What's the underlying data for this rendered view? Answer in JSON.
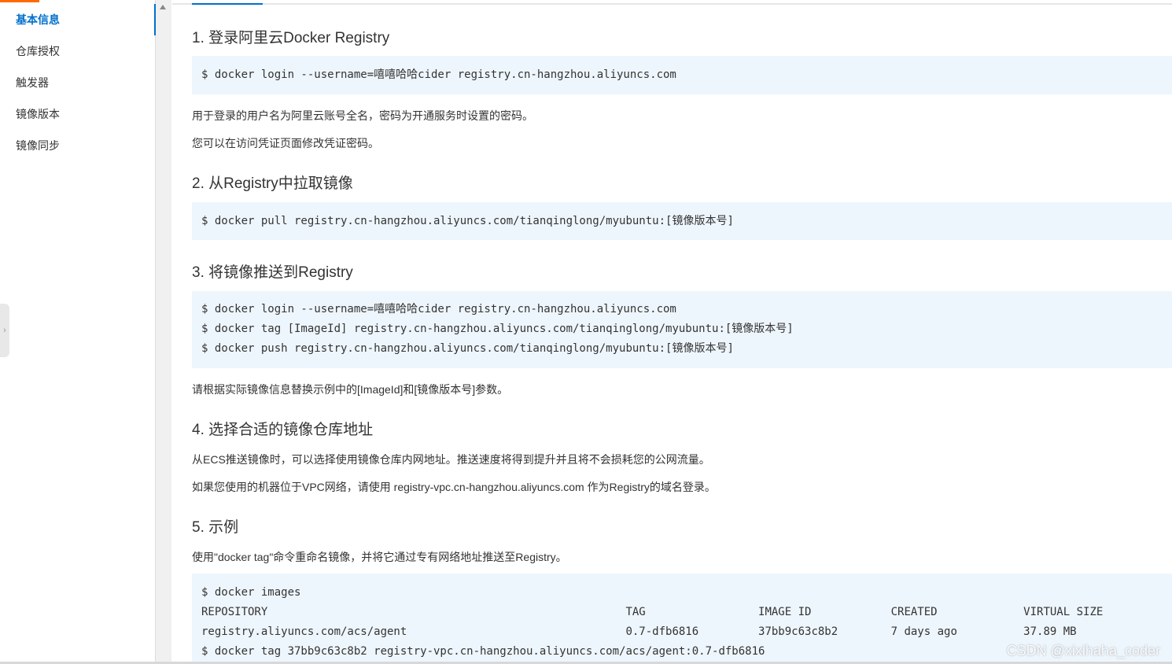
{
  "sidebar": {
    "items": [
      {
        "label": "基本信息",
        "active": true
      },
      {
        "label": "仓库授权"
      },
      {
        "label": "触发器"
      },
      {
        "label": "镜像版本"
      },
      {
        "label": "镜像同步"
      }
    ],
    "collapse_icon": "chevron-right-icon"
  },
  "colors": {
    "accent": "#0070cc",
    "brand": "#ff6a00",
    "code_bg": "#eef6fd"
  },
  "sections": {
    "s1": {
      "title": "1. 登录阿里云Docker Registry",
      "code": [
        "$ docker login --username=嘻嘻哈哈cider registry.cn-hangzhou.aliyuncs.com"
      ],
      "notes": [
        "用于登录的用户名为阿里云账号全名，密码为开通服务时设置的密码。",
        "您可以在访问凭证页面修改凭证密码。"
      ]
    },
    "s2": {
      "title": "2. 从Registry中拉取镜像",
      "code": [
        "$ docker pull registry.cn-hangzhou.aliyuncs.com/tianqinglong/myubuntu:[镜像版本号]"
      ]
    },
    "s3": {
      "title": "3. 将镜像推送到Registry",
      "code": [
        "$ docker login --username=嘻嘻哈哈cider registry.cn-hangzhou.aliyuncs.com",
        "$ docker tag [ImageId] registry.cn-hangzhou.aliyuncs.com/tianqinglong/myubuntu:[镜像版本号]",
        "$ docker push registry.cn-hangzhou.aliyuncs.com/tianqinglong/myubuntu:[镜像版本号]"
      ],
      "note": "请根据实际镜像信息替换示例中的[ImageId]和[镜像版本号]参数。"
    },
    "s4": {
      "title": "4. 选择合适的镜像仓库地址",
      "notes": [
        "从ECS推送镜像时，可以选择使用镜像仓库内网地址。推送速度将得到提升并且将不会损耗您的公网流量。",
        "如果您使用的机器位于VPC网络，请使用 registry-vpc.cn-hangzhou.aliyuncs.com 作为Registry的域名登录。"
      ]
    },
    "s5": {
      "title": "5. 示例",
      "note": "使用\"docker tag\"命令重命名镜像，并将它通过专有网络地址推送至Registry。",
      "code": [
        "$ docker images",
        "REPOSITORY                                                      TAG                 IMAGE ID            CREATED             VIRTUAL SIZE",
        "registry.aliyuncs.com/acs/agent                                 0.7-dfb6816         37bb9c63c8b2        7 days ago          37.89 MB",
        "$ docker tag 37bb9c63c8b2 registry-vpc.cn-hangzhou.aliyuncs.com/acs/agent:0.7-dfb6816"
      ]
    }
  },
  "watermark": "CSDN @xixihaha_coder"
}
